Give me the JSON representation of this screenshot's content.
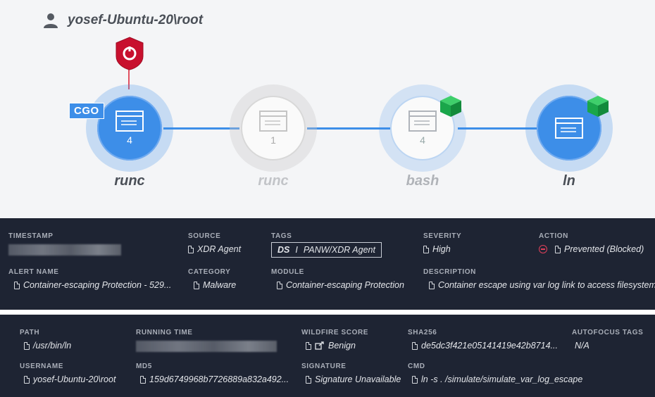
{
  "graph": {
    "user": "yosef-Ubuntu-20\\root",
    "badge": "CGO",
    "nodes": [
      {
        "label": "runc",
        "count": "4"
      },
      {
        "label": "runc",
        "count": "1"
      },
      {
        "label": "bash",
        "count": "4"
      },
      {
        "label": "ln",
        "count": ""
      }
    ]
  },
  "alert": {
    "timestamp_label": "TIMESTAMP",
    "source_label": "SOURCE",
    "source_value": "XDR Agent",
    "tags_label": "TAGS",
    "tag_ds": "DS",
    "tag_sep": "I",
    "tag_value": "PANW/XDR Agent",
    "severity_label": "SEVERITY",
    "severity_value": "High",
    "action_label": "ACTION",
    "action_value": "Prevented (Blocked)",
    "alert_name_label": "ALERT NAME",
    "alert_name_value": "Container-escaping Protection - 529...",
    "category_label": "CATEGORY",
    "category_value": "Malware",
    "module_label": "MODULE",
    "module_value": "Container-escaping Protection",
    "description_label": "DESCRIPTION",
    "description_value": "Container escape using var log link to access filesystem"
  },
  "process": {
    "path_label": "PATH",
    "path_value": "/usr/bin/ln",
    "running_time_label": "RUNNING TIME",
    "wildfire_label": "WILDFIRE SCORE",
    "wildfire_value": "Benign",
    "sha256_label": "SHA256",
    "sha256_value": "de5dc3f421e05141419e42b8714...",
    "autofocus_label": "AUTOFOCUS TAGS",
    "autofocus_value": "N/A",
    "username_label": "USERNAME",
    "username_value": "yosef-Ubuntu-20\\root",
    "md5_label": "MD5",
    "md5_value": "159d6749968b7726889a832a492...",
    "signature_label": "SIGNATURE",
    "signature_value": "Signature Unavailable",
    "cmd_label": "CMD",
    "cmd_value": "ln -s . /simulate/simulate_var_log_escape"
  },
  "colors": {
    "accent": "#3d8ee8",
    "panel": "#1e2433",
    "alert_red": "#c8102e",
    "cube_green": "#1aa64a"
  }
}
